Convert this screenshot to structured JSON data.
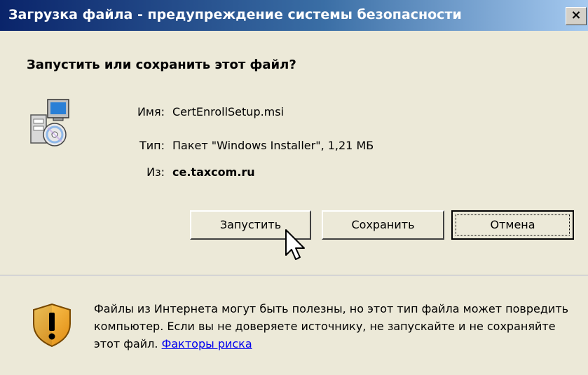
{
  "window": {
    "title": "Загрузка файла - предупреждение системы безопасности",
    "close_glyph": "×"
  },
  "dialog": {
    "heading": "Запустить или сохранить этот файл?",
    "file_icon": "installer-package-icon",
    "fields": {
      "name_label": "Имя:",
      "name_value": "CertEnrollSetup.msi",
      "type_label": "Тип:",
      "type_value": "Пакет \"Windows Installer\", 1,21 МБ",
      "from_label": "Из:",
      "from_value": "ce.taxcom.ru"
    },
    "buttons": {
      "run_label": "Запустить",
      "save_label": "Сохранить",
      "cancel_label": "Отмена"
    }
  },
  "warning": {
    "icon": "security-shield-warning-icon",
    "text": "Файлы из Интернета могут быть полезны, но этот тип файла может повредить компьютер. Если вы не доверяете источнику, не запускайте и не сохраняйте этот файл.",
    "link_label": "Факторы риска"
  },
  "colors": {
    "titlebar_start": "#0a246a",
    "titlebar_end": "#a6caf0",
    "dialog_background": "#ece9d8",
    "link": "#0000ee",
    "shield_orange": "#f0a020"
  }
}
